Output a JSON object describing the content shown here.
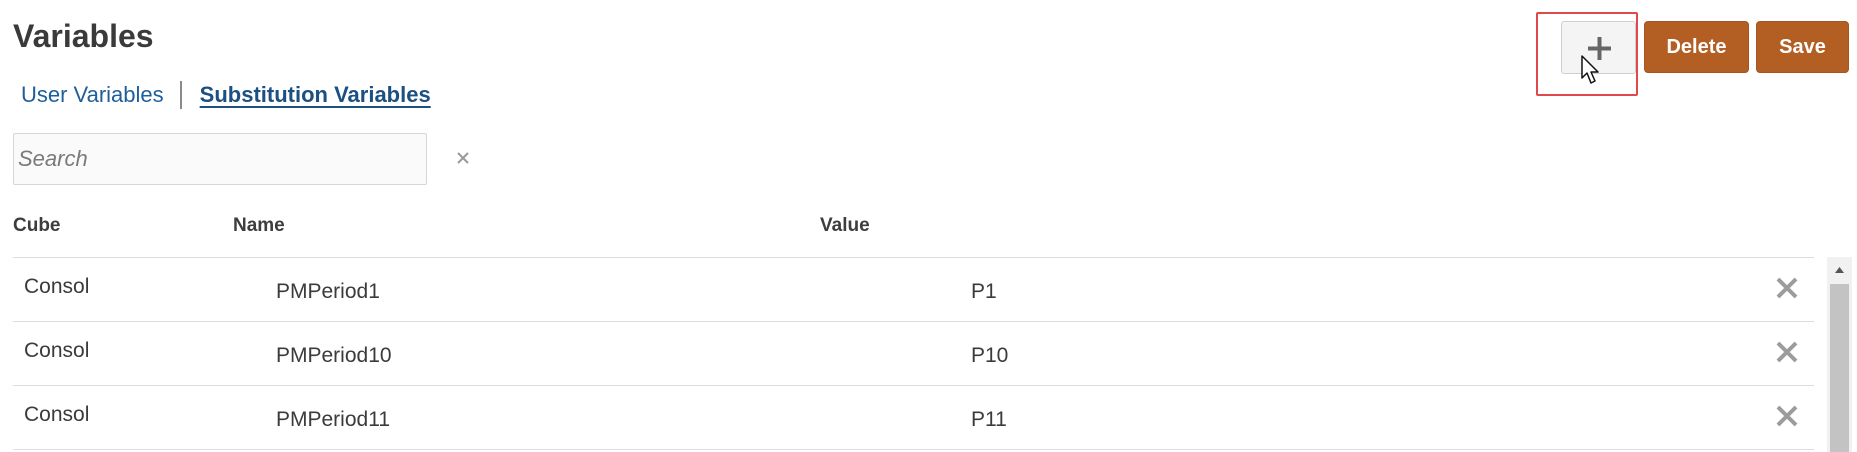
{
  "page": {
    "title": "Variables"
  },
  "tabs": [
    {
      "label": "User Variables",
      "active": false
    },
    {
      "label": "Substitution Variables",
      "active": true
    }
  ],
  "search": {
    "placeholder": "Search",
    "value": "",
    "clear_icon": "close-icon"
  },
  "toolbar": {
    "add_icon": "plus-icon",
    "delete_label": "Delete",
    "save_label": "Save",
    "accent_color": "#b35f23"
  },
  "table": {
    "columns": [
      "Cube",
      "Name",
      "Value"
    ],
    "rows": [
      {
        "cube": "Consol",
        "name": "PMPeriod1",
        "value": "P1"
      },
      {
        "cube": "Consol",
        "name": "PMPeriod10",
        "value": "P10"
      },
      {
        "cube": "Consol",
        "name": "PMPeriod11",
        "value": "P11"
      }
    ],
    "row_delete_icon": "close-icon"
  }
}
